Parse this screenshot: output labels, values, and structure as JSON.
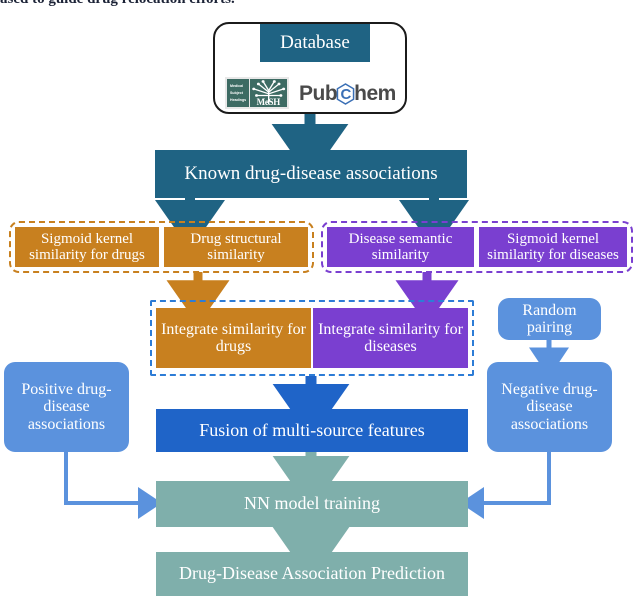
{
  "caption": {
    "clipped_text": "ased to guide drug relocation efforts."
  },
  "colors": {
    "teal_dark": "#1f6383",
    "orange": "#c8801f",
    "purple": "#7a3fd0",
    "blue_bright": "#1f64c8",
    "blue_light": "#5b92dd",
    "teal_gray": "#7fafab",
    "dash_blue": "#2d7cd6",
    "arrow_blue_light": "#5b92dd",
    "mesh_green": "#3d6b63",
    "pubchem_gray": "#4a4a4a",
    "pubchem_blue": "#3a6fb5"
  },
  "diagram": {
    "database_group": {
      "title": "Database",
      "sources": [
        {
          "name": "mesh-logo",
          "left_label_lines": [
            "Medical",
            "Subject",
            "Headings"
          ],
          "wordmark": "MeSH"
        },
        {
          "name": "pubchem-logo",
          "wordmark_part1": "Pub",
          "wordmark_hex_letter": "C",
          "wordmark_part2": "hem"
        }
      ]
    },
    "known_associations": {
      "label": "Known drug-disease associations"
    },
    "drug_similarity_group": {
      "items": [
        {
          "label": "Sigmoid kernel similarity for drugs"
        },
        {
          "label": "Drug structural similarity"
        }
      ]
    },
    "disease_similarity_group": {
      "items": [
        {
          "label": "Disease semantic similarity"
        },
        {
          "label": "Sigmoid kernel similarity for diseases"
        }
      ]
    },
    "integrate_group": {
      "items": [
        {
          "label": "Integrate similarity for drugs"
        },
        {
          "label": "Integrate similarity for diseases"
        }
      ]
    },
    "random_pairing": {
      "label": "Random pairing"
    },
    "positive_associations": {
      "label": "Positive drug-disease associations"
    },
    "negative_associations": {
      "label": "Negative drug-disease associations"
    },
    "fusion": {
      "label": "Fusion of multi-source features"
    },
    "nn_training": {
      "label": "NN model training"
    },
    "prediction": {
      "label": "Drug-Disease Association Prediction"
    }
  }
}
